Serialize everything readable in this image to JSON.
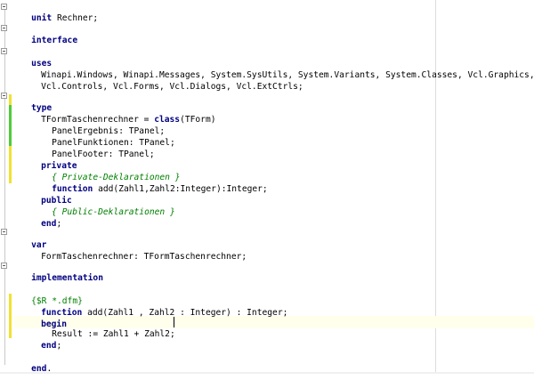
{
  "editor": {
    "lines": {
      "l01": {
        "kw": "unit",
        "text": " Rechner;"
      },
      "l02": {
        "kw": "interface"
      },
      "l03": {
        "kw": "uses"
      },
      "l04": {
        "text": "Winapi.Windows, Winapi.Messages, System.SysUtils, System.Variants, System.Classes, Vcl.Graphics,"
      },
      "l05": {
        "text": "Vcl.Controls, Vcl.Forms, Vcl.Dialogs, Vcl.ExtCtrls;"
      },
      "l06": {
        "kw": "type"
      },
      "l07": {
        "pre": "TFormTaschenrechner = ",
        "kw": "class",
        "post": "(TForm)"
      },
      "l08": {
        "text": "PanelErgebnis: TPanel;"
      },
      "l09": {
        "text": "PanelFunktionen: TPanel;"
      },
      "l10": {
        "text": "PanelFooter: TPanel;"
      },
      "l11": {
        "kw": "private"
      },
      "l12": {
        "comment": "{ Private-Deklarationen }"
      },
      "l13": {
        "kw": "function",
        "post": " add(Zahl1,Zahl2:Integer):Integer;"
      },
      "l14": {
        "kw": "public"
      },
      "l15": {
        "comment": "{ Public-Deklarationen }"
      },
      "l16": {
        "kw": "end",
        "post": ";"
      },
      "l17": {
        "kw": "var"
      },
      "l18": {
        "text": "FormTaschenrechner: TFormTaschenrechner;"
      },
      "l19": {
        "kw": "implementation"
      },
      "l20": {
        "directive": "{$R *.dfm}"
      },
      "l21": {
        "kw": "function",
        "post": " add(Zahl1 , Zahl2 : Integer) : Integer;"
      },
      "l22": {
        "kw": "begin"
      },
      "l23": {
        "text": "Result := Zahl1 + Zahl2;"
      },
      "l24": {
        "kw": "end",
        "post": ";"
      },
      "l25": {
        "kw": "end",
        "post": "."
      }
    },
    "colors": {
      "keyword": "#000080",
      "comment": "#008000",
      "modified_unsaved": "#f0e230",
      "modified_saved": "#4fcb3a",
      "current_line": "#ffffec"
    }
  }
}
